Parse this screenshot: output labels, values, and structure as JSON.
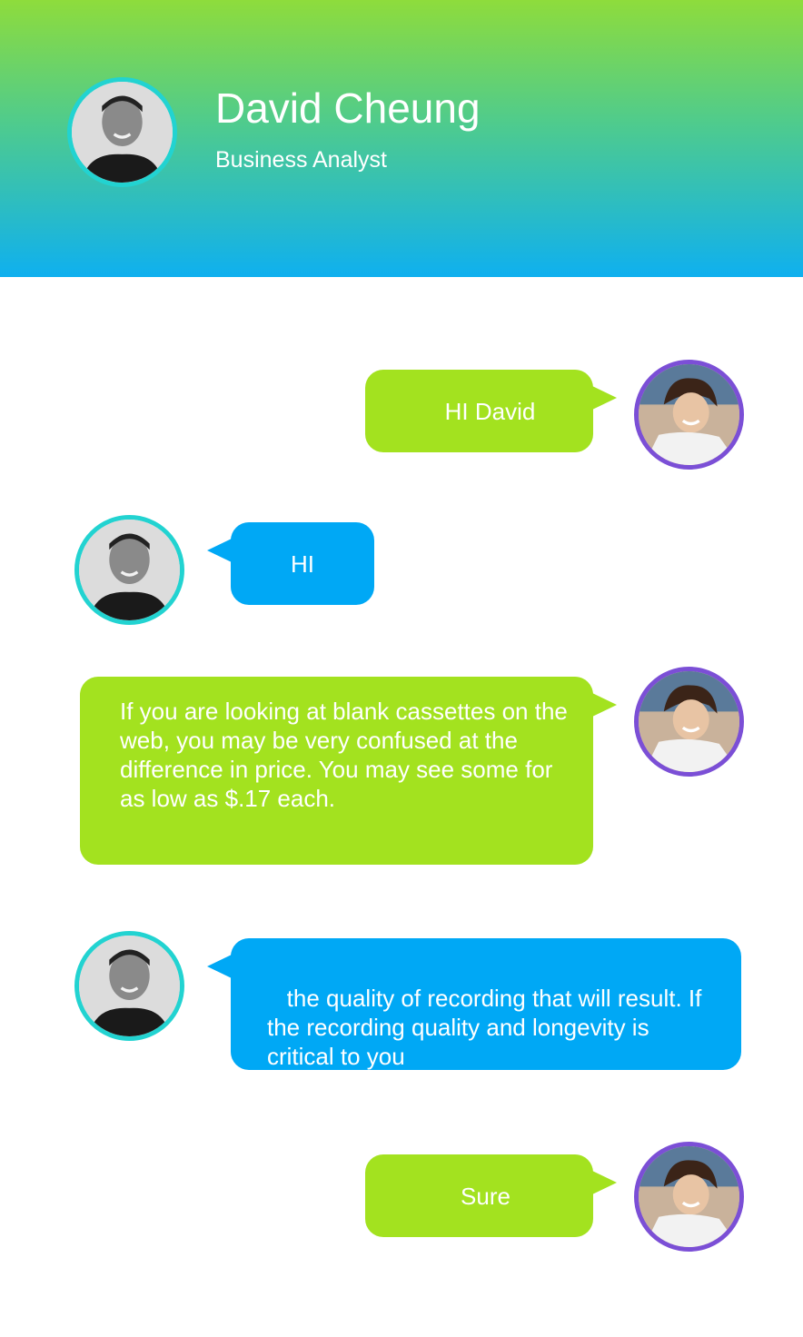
{
  "header": {
    "name": "David Cheung",
    "role": "Business Analyst"
  },
  "colors": {
    "outgoing_bubble": "#a3e21f",
    "incoming_bubble": "#00a8f5",
    "contact_avatar_ring": "#22d3d1",
    "user_avatar_ring": "#7b4fd6"
  },
  "messages": [
    {
      "sender": "me",
      "text": "HI David"
    },
    {
      "sender": "contact",
      "text": "HI"
    },
    {
      "sender": "me",
      "text": "If you are looking at blank cassettes on the web, you may be very confused at the difference in price. You may see some for as low as $.17 each."
    },
    {
      "sender": "contact",
      "text": " the quality of recording that will result. If the recording quality and longevity is critical to you"
    },
    {
      "sender": "me",
      "text": "Sure"
    }
  ]
}
